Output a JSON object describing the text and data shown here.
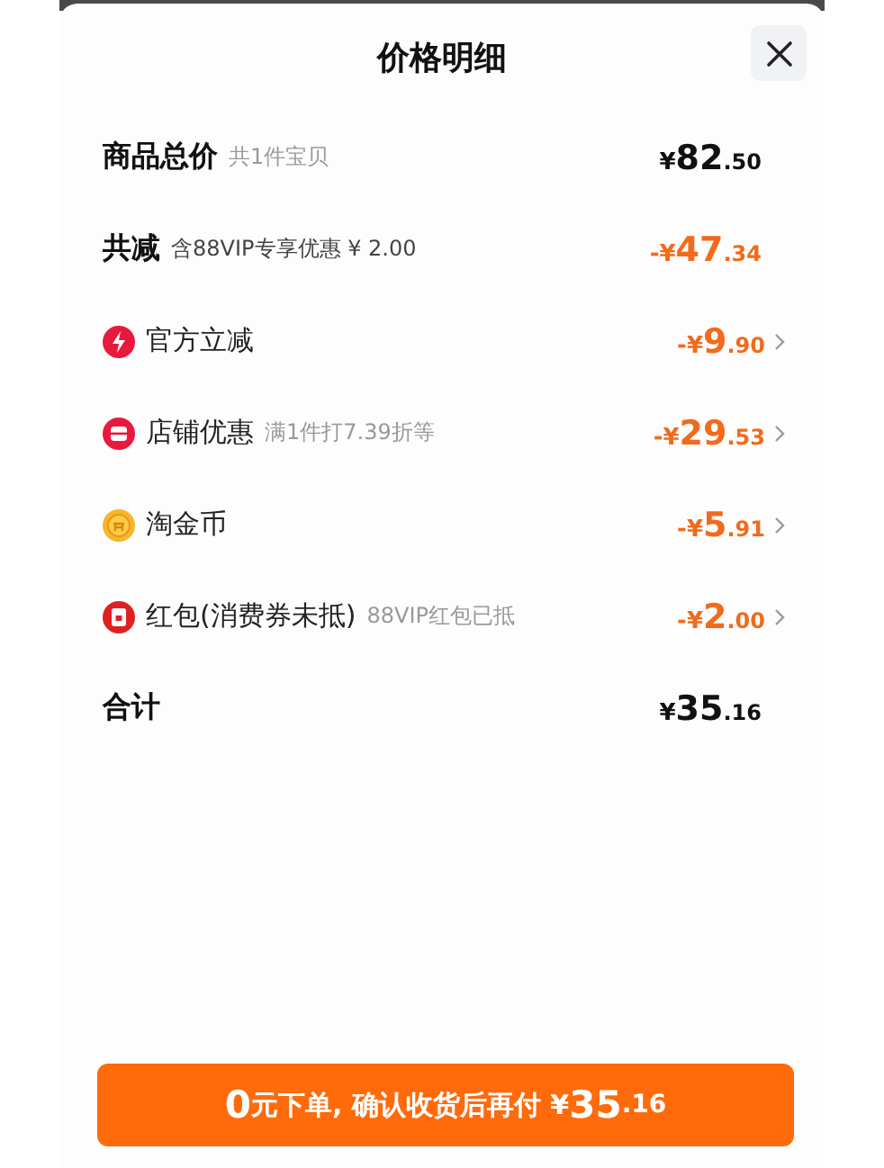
{
  "title": "价格明细",
  "rows": [
    {
      "kind": "summary",
      "label": "商品总价",
      "note": "共1件宝贝",
      "amount": "¥82.50"
    },
    {
      "kind": "summary",
      "label": "共减",
      "note": "含88VIP专享优惠 ¥ 2.00",
      "amount": "-¥47.34",
      "discount": true
    },
    {
      "kind": "discount",
      "label": "官方立减",
      "amount": "-¥9.90"
    },
    {
      "kind": "discount",
      "label": "店铺优惠",
      "note": "满1件打7.39折等",
      "amount": "-¥29.53"
    },
    {
      "kind": "discount",
      "label": "淘金币",
      "amount": "-¥5.91"
    },
    {
      "kind": "discount",
      "label": "红包(消费券未抵)",
      "note": "88VIP红包已抵",
      "amount": "-¥2.00"
    },
    {
      "kind": "summary",
      "label": "合计",
      "amount": "¥35.16"
    }
  ],
  "pay_button": "0元下单, 确认收货后再付 ¥35.16"
}
